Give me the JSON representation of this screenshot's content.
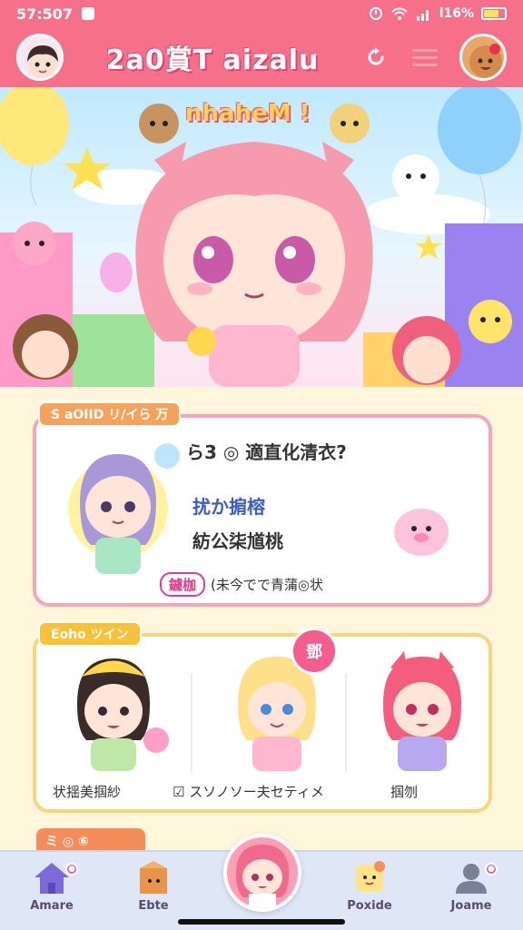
{
  "status_bar": {
    "time": "57:507",
    "battery_text": "l16%"
  },
  "header": {
    "title": "2a0賞T aizalu"
  },
  "hero": {
    "title": "nhaheM !"
  },
  "quiz_section": {
    "tag": "S aOIID リ/イら 万",
    "question": "ら3 ◎ 適直化清衣?",
    "option_1": "扰か掮榕",
    "option_2": "紡公柒馗桃",
    "footer_pill": "鑢枷",
    "footer_text": "(未今でで青蒲◎状"
  },
  "characters_section": {
    "tag": "Eoho ツイン",
    "new_badge": "鄧",
    "characters": [
      {
        "label": "状揺美掴紗"
      },
      {
        "label": "スソノソー夫セティメ"
      },
      {
        "label": "掴刎"
      }
    ],
    "middle_prefix": "☑"
  },
  "next_section": {
    "tag": "ミ ◎ ⑥"
  },
  "bottom_nav": {
    "items": [
      {
        "label": "Amare",
        "badge": "●"
      },
      {
        "label": "Ebte"
      },
      {
        "label": "Poxide"
      },
      {
        "label": "Joame",
        "badge": "●"
      }
    ]
  },
  "colors": {
    "header_pink": "#f7708a",
    "quiz_border": "#f6a6b4",
    "chars_border": "#f7d77a",
    "tag_orange": "#f7a25a",
    "nav_bg": "#dfe6f6"
  }
}
